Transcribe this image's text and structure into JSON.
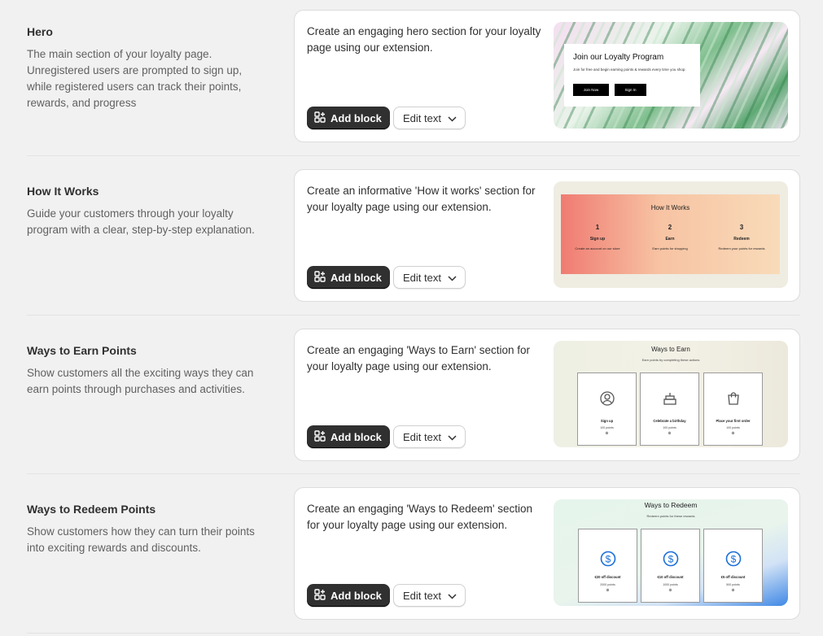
{
  "sections": [
    {
      "title": "Hero",
      "description": "The main section of your loyalty page. Unregistered users are prompted to sign up, while registered users can track their points, rewards, and progress",
      "card_text": "Create an engaging hero section for your loyalty page using our extension.",
      "add_label": "Add block",
      "edit_label": "Edit text",
      "preview": {
        "title": "Join our Loyalty Program",
        "subtitle": "Join for free and begin earning points & rewards every time you shop.",
        "join_label": "Join Now",
        "signin_label": "Sign In"
      }
    },
    {
      "title": "How It Works",
      "description": "Guide your customers through your loyalty program with a clear, step-by-step explanation.",
      "card_text": "Create an informative 'How it works' section for your loyalty page using our extension.",
      "add_label": "Add block",
      "edit_label": "Edit text",
      "preview": {
        "title": "How It Works",
        "steps": [
          {
            "number": "1",
            "title": "Sign up",
            "desc": "Create an account on our store"
          },
          {
            "number": "2",
            "title": "Earn",
            "desc": "Earn points for shopping"
          },
          {
            "number": "3",
            "title": "Redeem",
            "desc": "Redeem your points for rewards"
          }
        ]
      }
    },
    {
      "title": "Ways to Earn Points",
      "description": "Show customers all the exciting ways they can earn points through purchases and activities.",
      "card_text": "Create an engaging 'Ways to Earn' section for your loyalty page using our extension.",
      "add_label": "Add block",
      "edit_label": "Edit text",
      "preview": {
        "title": "Ways to Earn",
        "subtitle": "Earn points by completing these actions",
        "tiles": [
          {
            "icon": "user-circle-icon",
            "label": "Sign up",
            "points": "100 points"
          },
          {
            "icon": "cake-icon",
            "label": "Celebrate a birthday",
            "points": "100 points"
          },
          {
            "icon": "shopping-bag-icon",
            "label": "Place your first order",
            "points": "100 points"
          }
        ]
      }
    },
    {
      "title": "Ways to Redeem Points",
      "description": "Show customers how they can turn their points into exciting rewards and discounts.",
      "card_text": "Create an engaging 'Ways to Redeem' section for your loyalty page using our extension.",
      "add_label": "Add block",
      "edit_label": "Edit text",
      "preview": {
        "title": "Ways to Redeem",
        "subtitle": "Redeem points for these rewards",
        "tiles": [
          {
            "icon": "dollar-coin-icon",
            "label": "€20 off discount",
            "points": "2000 points"
          },
          {
            "icon": "dollar-coin-icon",
            "label": "€10 off discount",
            "points": "1000 points"
          },
          {
            "icon": "dollar-coin-icon",
            "label": "€5 off discount",
            "points": "500 points"
          }
        ]
      }
    }
  ],
  "colors": {
    "primary_button": "#303030",
    "page_bg": "#f1f1f1",
    "coin_blue": "#1a6fd8"
  }
}
